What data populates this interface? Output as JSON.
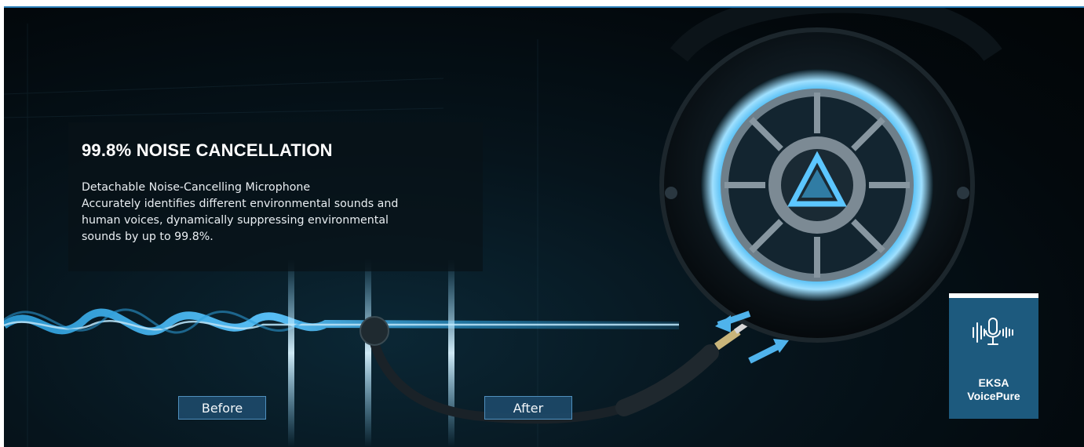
{
  "feature": {
    "headline": "99.8% NOISE CANCELLATION",
    "description_lines": [
      "Detachable Noise-Cancelling Microphone",
      "Accurately identifies different environmental sounds and",
      "human voices, dynamically suppressing environmental",
      "sounds by up to 99.8%."
    ]
  },
  "comparison": {
    "before_label": "Before",
    "after_label": "After"
  },
  "badge": {
    "icon": "microphone-waveform-icon",
    "brand": "EKSA",
    "name": "VoicePure"
  },
  "colors": {
    "accent_blue": "#2fa8e8",
    "badge_bg": "#1d5a7e",
    "glow": "#7fd4ff"
  }
}
